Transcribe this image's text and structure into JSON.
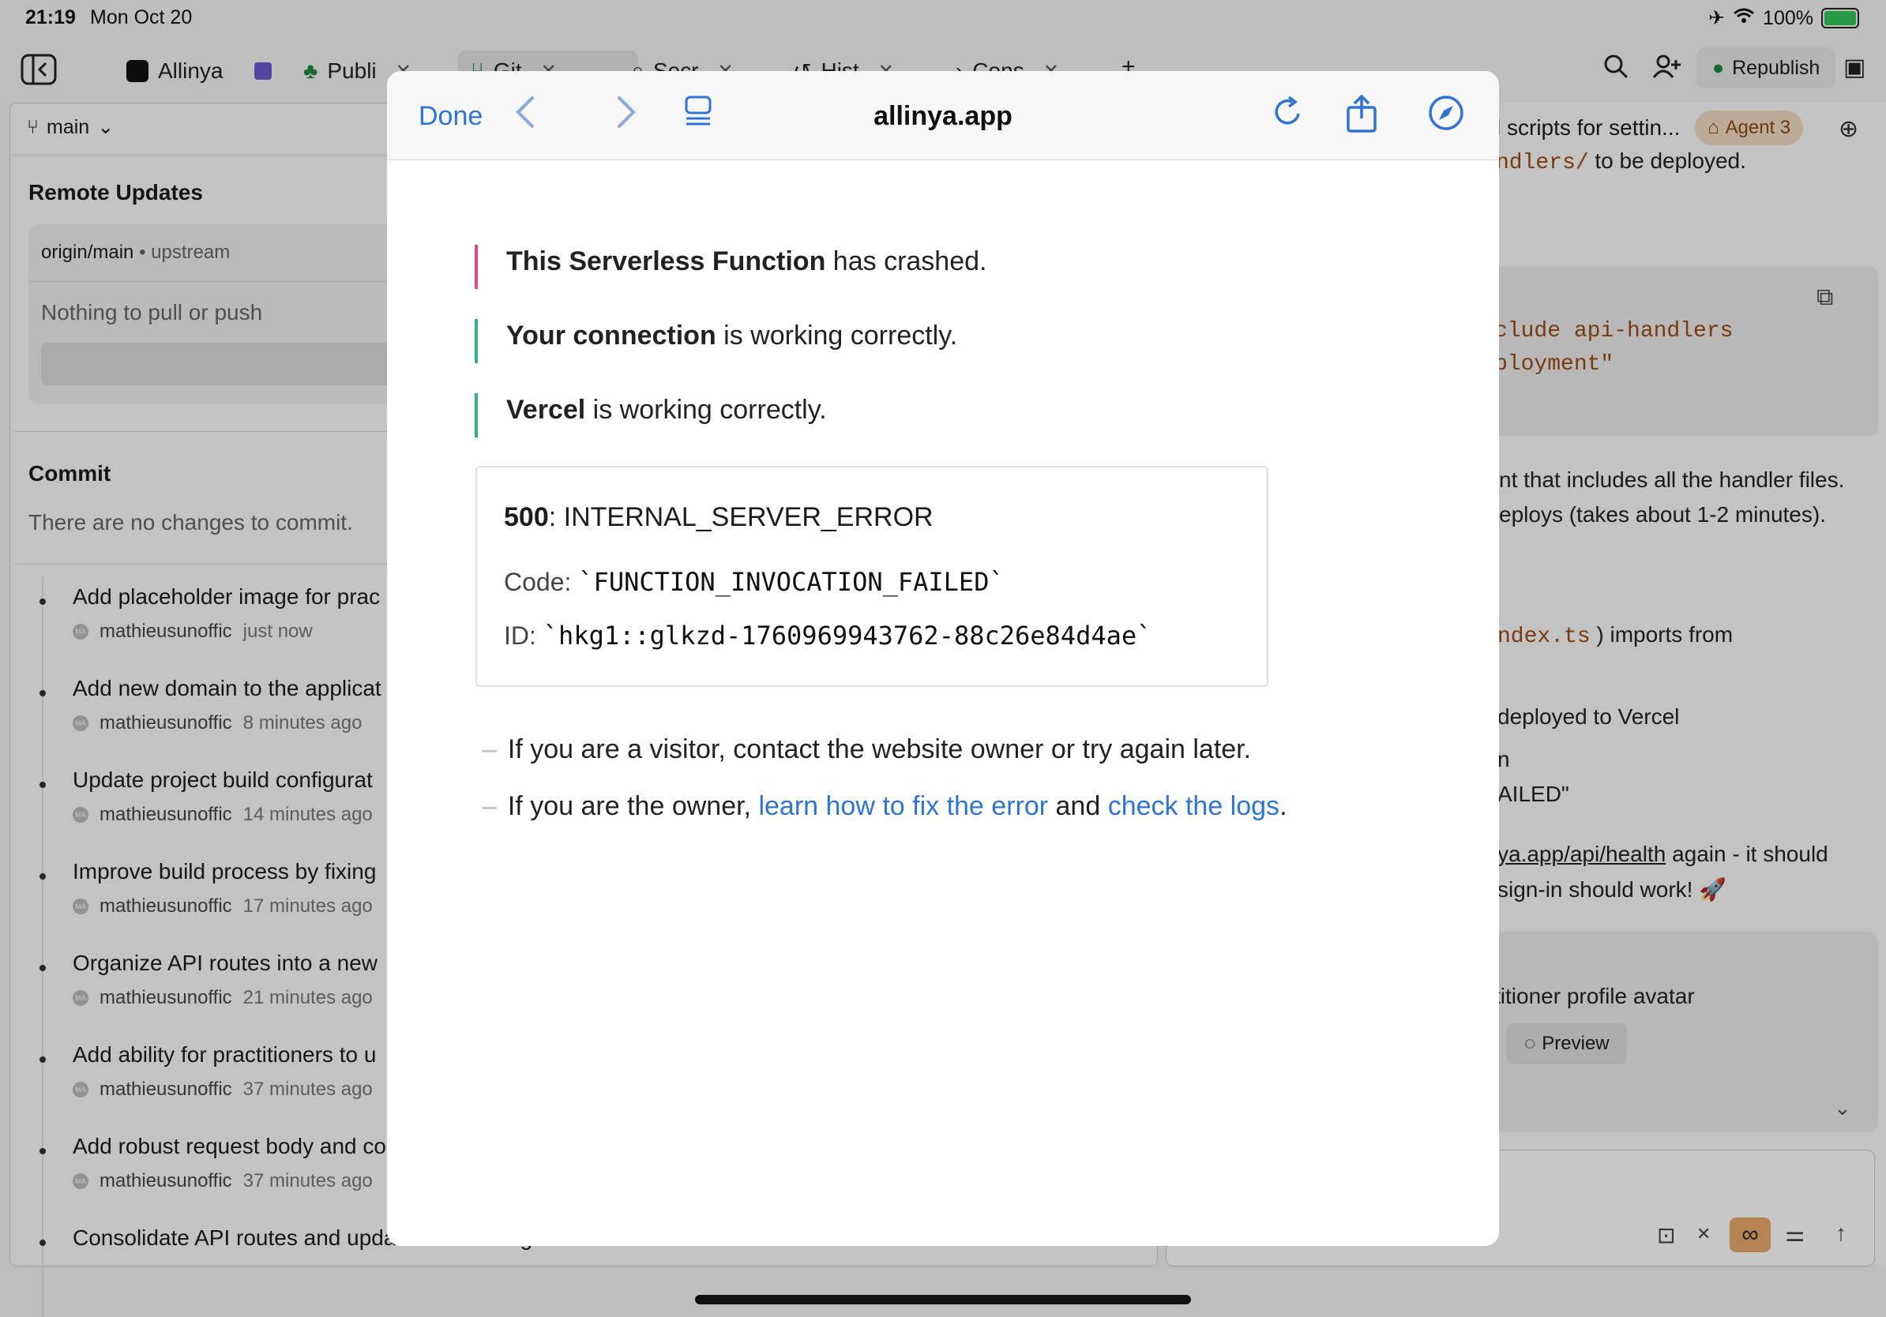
{
  "status": {
    "time": "21:19",
    "date": "Mon Oct 20",
    "battery": "100%"
  },
  "tabs": [
    {
      "label": "Allinya",
      "icon": "app-icon"
    },
    {
      "label": "Publi",
      "icon": "tree-icon"
    },
    {
      "label": "Git",
      "icon": "git-icon"
    },
    {
      "label": "Secr",
      "icon": "lock-icon"
    },
    {
      "label": "Hist",
      "icon": "history-icon"
    },
    {
      "label": "Cons",
      "icon": "console-icon"
    }
  ],
  "toolbar": {
    "republish_label": "Republish"
  },
  "git": {
    "branch": "main",
    "remote_title": "Remote Updates",
    "remote_branch": "origin/main",
    "remote_separator": "•",
    "remote_upstream": "upstream",
    "remote_message": "Nothing to pull or push",
    "commit_title": "Commit",
    "commit_message": "There are no changes to commit.",
    "commits": [
      {
        "title": "Add placeholder image for prac",
        "author": "mathieusunoffic",
        "ago": "just now"
      },
      {
        "title": "Add new domain to the applicat",
        "author": "mathieusunoffic",
        "ago": "8 minutes ago"
      },
      {
        "title": "Update project build configurat",
        "author": "mathieusunoffic",
        "ago": "14 minutes ago"
      },
      {
        "title": "Improve build process by fixing",
        "author": "mathieusunoffic",
        "ago": "17 minutes ago"
      },
      {
        "title": "Organize API routes into a new",
        "author": "mathieusunoffic",
        "ago": "21 minutes ago"
      },
      {
        "title": "Add ability for practitioners to u",
        "author": "mathieusunoffic",
        "ago": "37 minutes ago"
      },
      {
        "title": "Add robust request body and co",
        "author": "mathieusunoffic",
        "ago": "37 minutes ago"
      },
      {
        "title": "Consolidate API routes and update build configuration",
        "author": "",
        "ago": ""
      }
    ],
    "avatar_initials": "MA"
  },
  "chat": {
    "header": "l scripts for settin...",
    "agent_label": "Agent 3",
    "line1_code": "ndlers/",
    "line1_text": "to be deployed.",
    "code_line1": "clude api-handlers",
    "code_line2": "ployment\"",
    "p1": "nt that includes all the handler files.",
    "p2": "eploys (takes about 1-2 minutes).",
    "p3_code": "ndex.ts",
    "p3_text": ") imports from",
    "p4": "deployed to Vercel",
    "p5": "n",
    "p6": "AILED\"",
    "p7_link": "ya.app/api/health",
    "p7_text": "again - it should",
    "p8": "sign-in should work! 🚀",
    "task": "titioner profile avatar",
    "preview_label": "Preview"
  },
  "modal": {
    "done_label": "Done",
    "title": "allinya.app",
    "lines": [
      {
        "bold": "This Serverless Function",
        "rest": " has crashed.",
        "color": "#e8457a"
      },
      {
        "bold": "Your connection",
        "rest": " is working correctly.",
        "color": "#2fb37e"
      },
      {
        "bold": "Vercel",
        "rest": " is working correctly.",
        "color": "#2fb37e"
      }
    ],
    "error_code_num": "500",
    "error_code_text": ": INTERNAL_SERVER_ERROR",
    "code_label": "Code:",
    "code_value": "`FUNCTION_INVOCATION_FAILED`",
    "id_label": "ID:",
    "id_value": "`hkg1::glkzd-1760969943762-88c26e84d4ae`",
    "hint1": "If you are a visitor, contact the website owner or try again later.",
    "hint2_pre": "If you are the owner, ",
    "hint2_link1": "learn how to fix the error",
    "hint2_mid": " and ",
    "hint2_link2": "check the logs",
    "hint2_end": "."
  }
}
